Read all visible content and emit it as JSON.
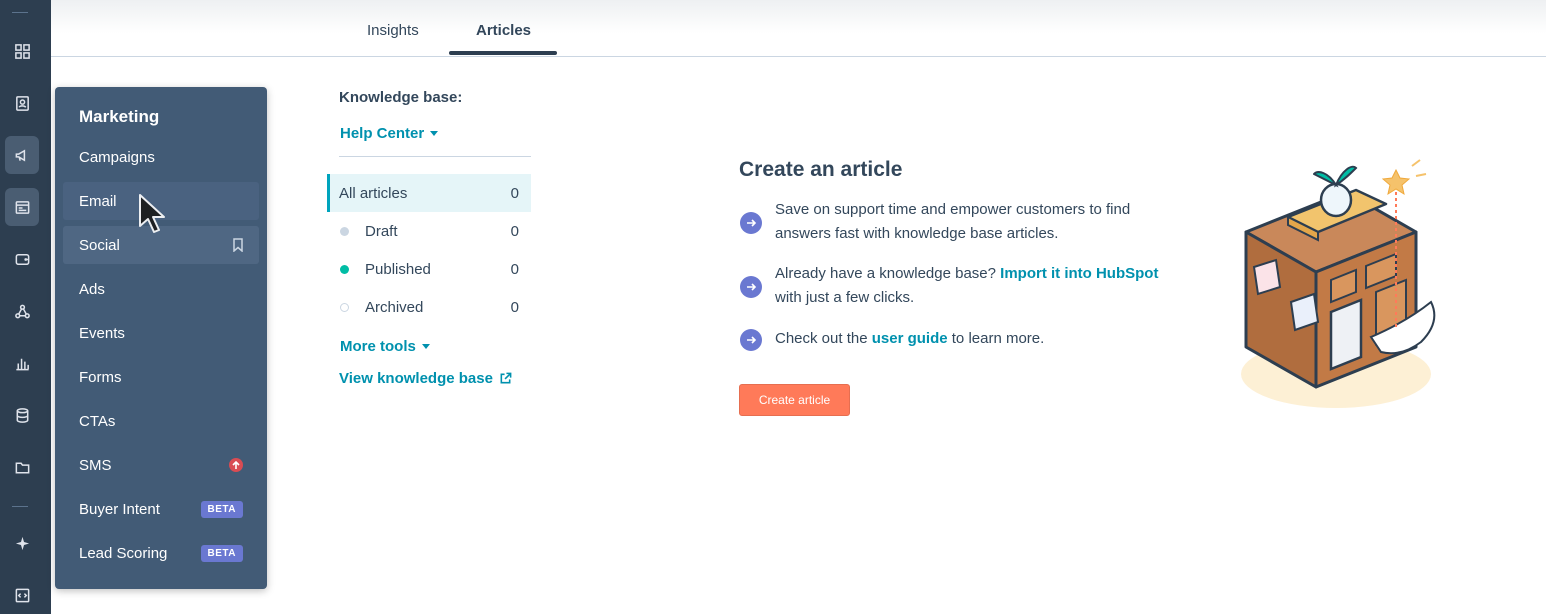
{
  "rail": {
    "icons": [
      "grid-icon",
      "contacts-icon",
      "megaphone-icon",
      "content-icon",
      "commerce-icon",
      "workflow-icon",
      "reports-icon",
      "database-icon",
      "folder-icon",
      "sparkle-icon",
      "code-icon"
    ]
  },
  "tabs": [
    {
      "label": "Insights",
      "active": false
    },
    {
      "label": "Articles",
      "active": true
    }
  ],
  "flyout": {
    "title": "Marketing",
    "items": [
      {
        "label": "Campaigns"
      },
      {
        "label": "Email"
      },
      {
        "label": "Social",
        "icon": "bookmark-icon"
      },
      {
        "label": "Ads"
      },
      {
        "label": "Events"
      },
      {
        "label": "Forms"
      },
      {
        "label": "CTAs"
      },
      {
        "label": "SMS",
        "icon": "upgrade-icon"
      },
      {
        "label": "Buyer Intent",
        "badge": "BETA"
      },
      {
        "label": "Lead Scoring",
        "badge": "BETA"
      }
    ]
  },
  "knowledge_base": {
    "label": "Knowledge base:",
    "selected": "Help Center",
    "filters": [
      {
        "label": "All articles",
        "count": "0",
        "selected": true
      },
      {
        "label": "Draft",
        "count": "0",
        "dot_color": "#cbd6e2"
      },
      {
        "label": "Published",
        "count": "0",
        "dot_color": "#00bda5"
      },
      {
        "label": "Archived",
        "count": "0",
        "dot_color": "#ffffff"
      }
    ],
    "more_tools": "More tools",
    "view_link": "View knowledge base"
  },
  "empty_state": {
    "title": "Create an article",
    "bullets": [
      {
        "before": "Save on support time and empower customers to find answers fast with knowledge base articles.",
        "link": "",
        "after": ""
      },
      {
        "before": "Already have a knowledge base? ",
        "link": "Import it into HubSpot",
        "after": " with just a few clicks."
      },
      {
        "before": "Check out the ",
        "link": "user guide",
        "after": " to learn more."
      }
    ],
    "button": "Create article"
  },
  "colors": {
    "rail_bg": "#2d3e50",
    "flyout_bg": "#425b76",
    "link": "#0091ae",
    "primary_button": "#ff7a59",
    "bullet": "#6a78d1",
    "beta_badge": "#6a78d1"
  }
}
